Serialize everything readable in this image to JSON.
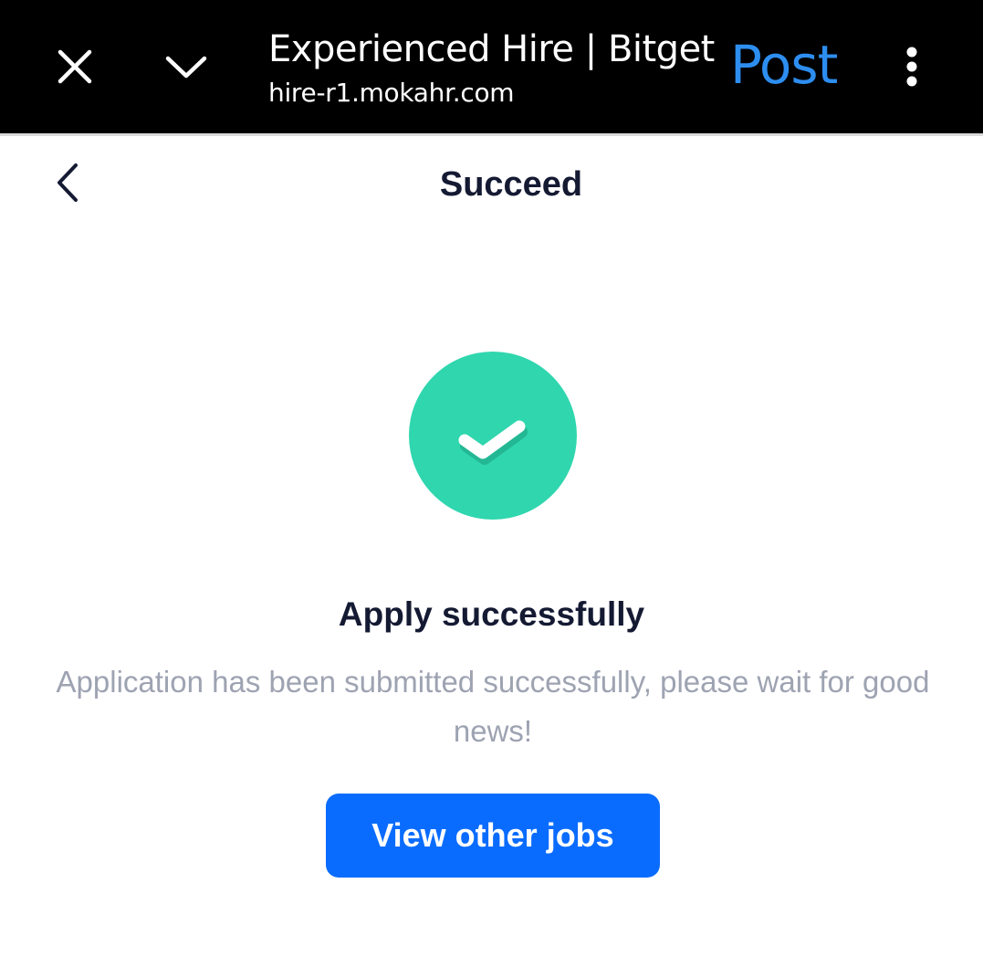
{
  "browser_bar": {
    "title": "Experienced Hire | Bitget",
    "url": "hire-r1.mokahr.com",
    "post_label": "Post",
    "icons": {
      "close": "close-icon",
      "collapse": "chevron-down-icon",
      "more": "more-vertical-icon"
    },
    "post_color": "#2d8ef0"
  },
  "header": {
    "title": "Succeed",
    "back_icon": "chevron-left-icon"
  },
  "result": {
    "icon": "check-circle-icon",
    "icon_color": "#2fd6ae",
    "title": "Apply successfully",
    "message": "Application has been submitted successfully, please wait for good news!",
    "button_label": "View other jobs",
    "button_color": "#0a6cff"
  }
}
